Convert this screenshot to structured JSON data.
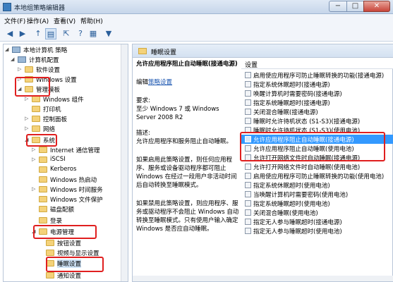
{
  "window": {
    "title": "本地组策略编辑器",
    "minimize": "−",
    "maximize": "□",
    "close": "✕"
  },
  "menu": [
    "文件(F)",
    "操作(A)",
    "查看(V)",
    "帮助(H)"
  ],
  "toolbar": {
    "back": "◀",
    "forward": "▶",
    "up": "↑",
    "show_hide": "▤",
    "export": "⇱",
    "help": "?",
    "properties": "▦",
    "filter": "▼"
  },
  "tree": [
    {
      "label": "本地计算机 策略",
      "arrow": "◢",
      "icon": "computer"
    },
    {
      "label": "计算机配置",
      "arrow": "◢",
      "icon": "computer"
    },
    {
      "label": "软件设置",
      "arrow": "▷",
      "icon": "folder"
    },
    {
      "label": "Windows 设置",
      "arrow": "▷",
      "icon": "folder"
    },
    {
      "label": "管理模板",
      "arrow": "◢",
      "icon": "folder"
    },
    {
      "label": "Windows 组件",
      "arrow": "▷",
      "icon": "folder"
    },
    {
      "label": "打印机",
      "arrow": "",
      "icon": "folder"
    },
    {
      "label": "控制面板",
      "arrow": "▷",
      "icon": "folder"
    },
    {
      "label": "网络",
      "arrow": "▷",
      "icon": "folder"
    },
    {
      "label": "系统",
      "arrow": "◢",
      "icon": "folder"
    },
    {
      "label": "Internet 通信管理",
      "arrow": "▷",
      "icon": "folder"
    },
    {
      "label": "iSCSI",
      "arrow": "▷",
      "icon": "folder"
    },
    {
      "label": "Kerberos",
      "arrow": "",
      "icon": "folder"
    },
    {
      "label": "Windows 热启动",
      "arrow": "",
      "icon": "folder"
    },
    {
      "label": "Windows 时间服务",
      "arrow": "▷",
      "icon": "folder"
    },
    {
      "label": "Windows 文件保护",
      "arrow": "",
      "icon": "folder"
    },
    {
      "label": "磁盘配额",
      "arrow": "",
      "icon": "folder"
    },
    {
      "label": "登录",
      "arrow": "",
      "icon": "folder"
    },
    {
      "label": "电源管理",
      "arrow": "◢",
      "icon": "folder"
    },
    {
      "label": "按钮设置",
      "arrow": "",
      "icon": "folder"
    },
    {
      "label": "视频与显示设置",
      "arrow": "",
      "icon": "folder"
    },
    {
      "label": "睡眠设置",
      "arrow": "",
      "icon": "folder"
    },
    {
      "label": "通知设置",
      "arrow": "",
      "icon": "folder"
    }
  ],
  "right": {
    "header": "睡眠设置",
    "policy_title": "允许应用程序阻止自动睡眠(接通电源)",
    "edit_prefix": "编辑",
    "edit_link": "策略设置",
    "req_label": "要求:",
    "req_text": "至少 Windows 7 或 Windows Server 2008 R2",
    "desc_label": "描述:",
    "desc_text": "允许应用程序和服务阻止自动睡眠。",
    "desc_enable": "如果启用此策略设置，则任何应用程序、服务或设备驱动程序都可阻止 Windows 在经过一段用户非活动时间后自动转换至睡眠模式。",
    "desc_disable": "如果禁用此策略设置，则应用程序、服务或驱动程序不会阻止 Windows 自动转换至睡眠模式。只有使用户输入确定 Windows 是否应自动睡眠。",
    "list_header": "设置",
    "items": [
      "启用使应用程序可防止睡眠转换的功能(接通电源)",
      "指定系统休眠超时(接通电源)",
      "唤醒计算机时需要密码(接通电源)",
      "指定系统睡眠超时(接通电源)",
      "关闭混合睡眠(接通电源)",
      "睡眠时允许待机状态 (S1-S3)(接通电源)",
      "睡眠时允许待机状态 (S1-S3)(使用电池)",
      "允许应用程序阻止自动睡眠(接通电源)",
      "允许应用程序阻止自动睡眠(使用电池)",
      "允许打开网络文件时自动睡眠(接通电源)",
      "允许打开网络文件时自动睡眠(使用电池)",
      "启用使应用程序可防止睡眠转换的功能(使用电池)",
      "指定系统休眠超时(使用电池)",
      "当唤醒计算机时需要密码(使用电池)",
      "指定系统睡眠超时(使用电池)",
      "关闭混合睡眠(使用电池)",
      "指定无人参与睡眠超时(接通电源)",
      "指定无人参与睡眠超时(使用电池)"
    ]
  }
}
